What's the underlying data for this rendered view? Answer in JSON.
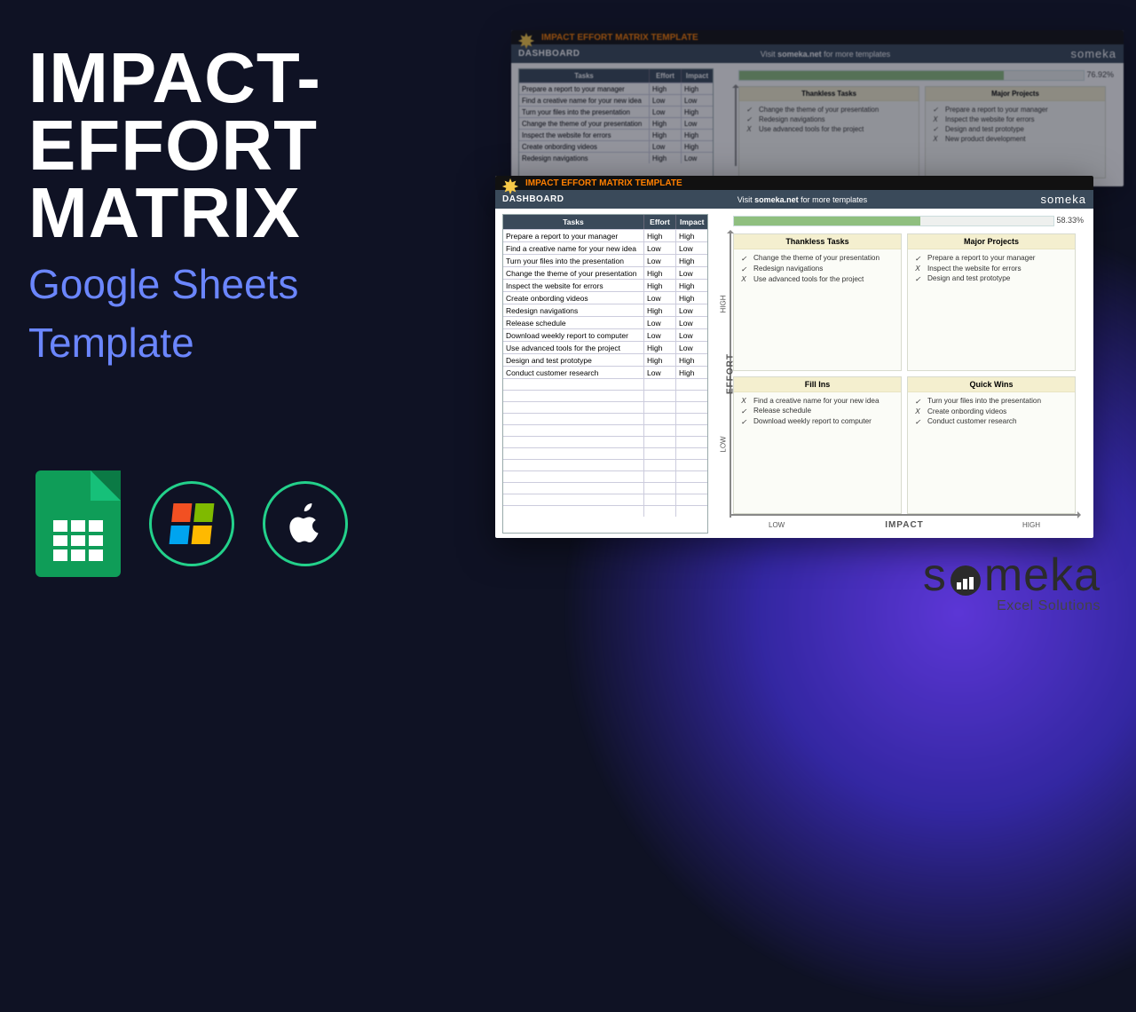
{
  "title": {
    "line1": "IMPACT-",
    "line2": "EFFORT",
    "line3": "MATRIX"
  },
  "subtitle": {
    "line1": "Google Sheets",
    "line2": "Template"
  },
  "icons": {
    "sheets": "google-sheets-icon",
    "windows": "windows-icon",
    "apple": "apple-icon"
  },
  "brand": {
    "name": "someka",
    "tag": "Excel Solutions"
  },
  "template": {
    "headerTitle": "IMPACT EFFORT MATRIX TEMPLATE",
    "dashboard": "DASHBOARD",
    "visit_prefix": "Visit ",
    "visit_site": "someka.net",
    "visit_suffix": " for more templates",
    "somekaMini": "someka",
    "columns": {
      "tasks": "Tasks",
      "effort": "Effort",
      "impact": "Impact"
    },
    "tasks": [
      {
        "name": "Prepare a report to your manager",
        "effort": "High",
        "impact": "High"
      },
      {
        "name": "Find a creative name for your new idea",
        "effort": "Low",
        "impact": "Low"
      },
      {
        "name": "Turn your files into the presentation",
        "effort": "Low",
        "impact": "High"
      },
      {
        "name": "Change the theme of your presentation",
        "effort": "High",
        "impact": "Low"
      },
      {
        "name": "Inspect the website for errors",
        "effort": "High",
        "impact": "High"
      },
      {
        "name": "Create onbording videos",
        "effort": "Low",
        "impact": "High"
      },
      {
        "name": "Redesign navigations",
        "effort": "High",
        "impact": "Low"
      },
      {
        "name": "Release schedule",
        "effort": "Low",
        "impact": "Low"
      },
      {
        "name": "Download weekly report to computer",
        "effort": "Low",
        "impact": "Low"
      },
      {
        "name": "Use advanced tools for the project",
        "effort": "High",
        "impact": "Low"
      },
      {
        "name": "Design and test prototype",
        "effort": "High",
        "impact": "High"
      },
      {
        "name": "Conduct customer research",
        "effort": "Low",
        "impact": "High"
      }
    ],
    "emptyRows": 12,
    "progressFront": "58.33%",
    "progressBack": "76.92%",
    "axis": {
      "effort": "EFFORT",
      "impact": "IMPACT",
      "low": "LOW",
      "high": "HIGH"
    },
    "quadrants": {
      "thankless": {
        "title": "Thankless Tasks",
        "items": [
          {
            "mark": "✓",
            "text": "Change the theme of your presentation"
          },
          {
            "mark": "✓",
            "text": "Redesign navigations"
          },
          {
            "mark": "X",
            "text": "Use advanced tools for the project"
          }
        ]
      },
      "major": {
        "title": "Major Projects",
        "items": [
          {
            "mark": "✓",
            "text": "Prepare a report to your manager"
          },
          {
            "mark": "X",
            "text": "Inspect the website for errors"
          },
          {
            "mark": "✓",
            "text": "Design and test prototype"
          }
        ]
      },
      "majorBackExtra": {
        "mark": "X",
        "text": "New product development"
      },
      "fillins": {
        "title": "Fill Ins",
        "items": [
          {
            "mark": "X",
            "text": "Find a creative name for your new idea"
          },
          {
            "mark": "✓",
            "text": "Release schedule"
          },
          {
            "mark": "✓",
            "text": "Download weekly report to computer"
          }
        ]
      },
      "quickwins": {
        "title": "Quick Wins",
        "items": [
          {
            "mark": "✓",
            "text": "Turn your files into the presentation"
          },
          {
            "mark": "X",
            "text": "Create onbording videos"
          },
          {
            "mark": "✓",
            "text": "Conduct customer research"
          }
        ]
      }
    }
  }
}
